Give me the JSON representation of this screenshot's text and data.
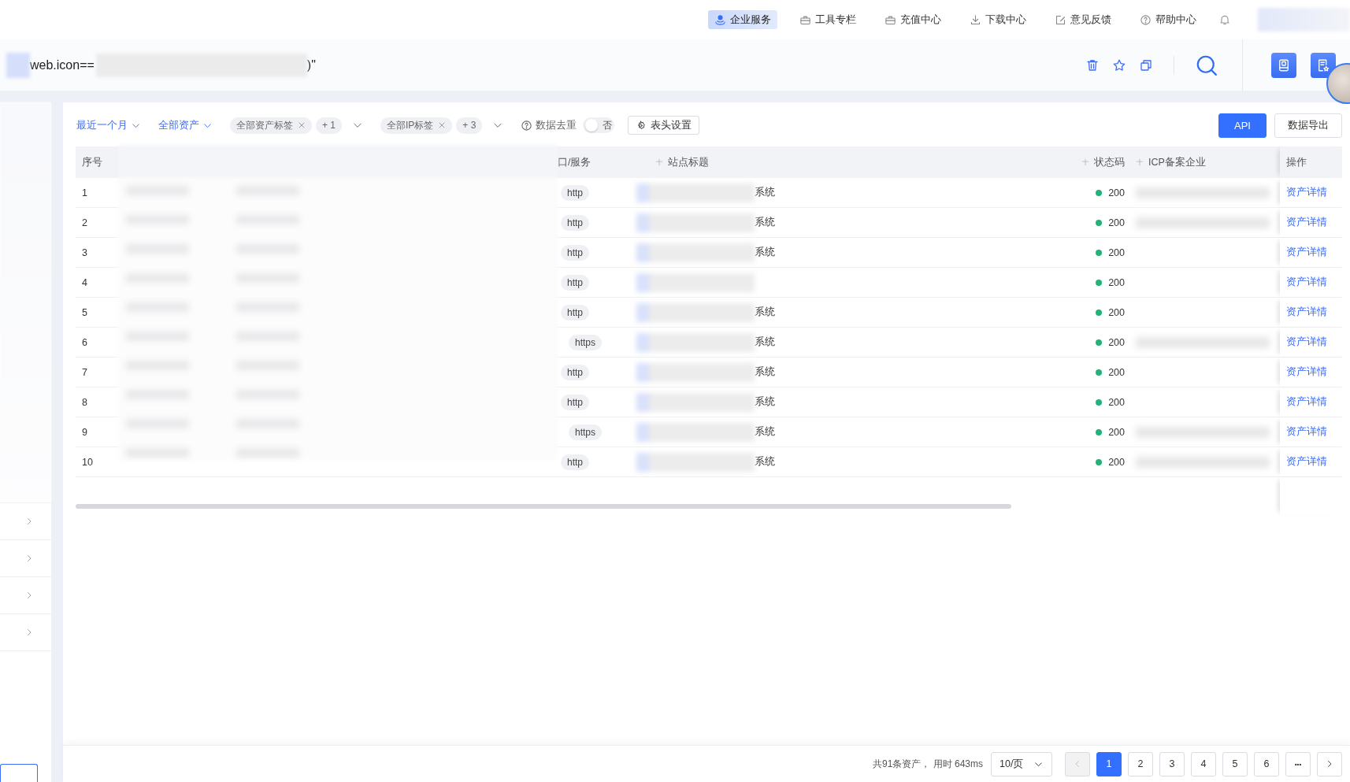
{
  "top_nav": {
    "items": [
      {
        "label": "企业服务",
        "selected": true
      },
      {
        "label": "工具专栏",
        "selected": false
      },
      {
        "label": "充值中心",
        "selected": false
      },
      {
        "label": "下载中心",
        "selected": false
      },
      {
        "label": "意见反馈",
        "selected": false
      },
      {
        "label": "帮助中心",
        "selected": false
      }
    ]
  },
  "search": {
    "query_prefix": "web.icon==",
    "query_suffix": ")\""
  },
  "sidebar": {
    "items": [
      {
        "expanded": false
      },
      {
        "expanded": false
      },
      {
        "expanded": false
      },
      {
        "expanded": false
      }
    ]
  },
  "filters": {
    "time": "最近一个月",
    "assets": "全部资产",
    "asset_tags": {
      "tag": "全部资产标签",
      "more": "+ 1"
    },
    "ip_tags": {
      "tag": "全部IP标签",
      "more": "+ 3"
    },
    "dedupe": {
      "label": "数据去重",
      "on": false,
      "state_text": "否"
    },
    "header_settings": "表头设置"
  },
  "actions": [
    {
      "label": "API",
      "kind": "primary"
    },
    {
      "label": "数据导出",
      "kind": "plain"
    }
  ],
  "table": {
    "columns": [
      {
        "label": "序号",
        "sortable": false
      },
      {
        "label": "口/服务",
        "sortable": false
      },
      {
        "label": "站点标题",
        "sortable": true
      },
      {
        "label": "状态码",
        "sortable": true
      },
      {
        "label": "ICP备案企业",
        "sortable": true
      },
      {
        "label": "操作",
        "sortable": false
      }
    ],
    "rows": [
      {
        "index": "1",
        "protocol": "http",
        "title_suffix": "系统",
        "status": "200",
        "icp_blurred": true,
        "action": "资产详情"
      },
      {
        "index": "2",
        "protocol": "http",
        "title_suffix": "系统",
        "status": "200",
        "icp_blurred": true,
        "action": "资产详情"
      },
      {
        "index": "3",
        "protocol": "http",
        "title_suffix": "系统",
        "status": "200",
        "icp_blurred": false,
        "action": "资产详情"
      },
      {
        "index": "4",
        "protocol": "http",
        "status": "200",
        "icp_blurred": false,
        "action": "资产详情"
      },
      {
        "index": "5",
        "protocol": "http",
        "title_suffix": "系统",
        "status": "200",
        "icp_blurred": false,
        "action": "资产详情"
      },
      {
        "index": "6",
        "protocol": "https",
        "title_suffix": "系统",
        "status": "200",
        "icp_blurred": true,
        "action": "资产详情"
      },
      {
        "index": "7",
        "protocol": "http",
        "title_suffix": "系统",
        "status": "200",
        "icp_blurred": false,
        "action": "资产详情"
      },
      {
        "index": "8",
        "protocol": "http",
        "title_suffix": "系统",
        "status": "200",
        "icp_blurred": false,
        "action": "资产详情"
      },
      {
        "index": "9",
        "protocol": "https",
        "title_suffix": "系统",
        "status": "200",
        "icp_blurred": true,
        "action": "资产详情"
      },
      {
        "index": "10",
        "protocol": "http",
        "title_suffix": "系统",
        "status": "200",
        "icp_blurred": true,
        "action": "资产详情"
      }
    ]
  },
  "pagination": {
    "summary": "共91条资产， 用时 643ms",
    "page_size": "10/页",
    "prev_disabled": true,
    "pages": [
      {
        "label": "1",
        "selected": true
      },
      {
        "label": "2",
        "selected": false
      },
      {
        "label": "3",
        "selected": false
      },
      {
        "label": "4",
        "selected": false
      },
      {
        "label": "5",
        "selected": false
      },
      {
        "label": "6",
        "selected": false
      }
    ],
    "more": "•••"
  }
}
